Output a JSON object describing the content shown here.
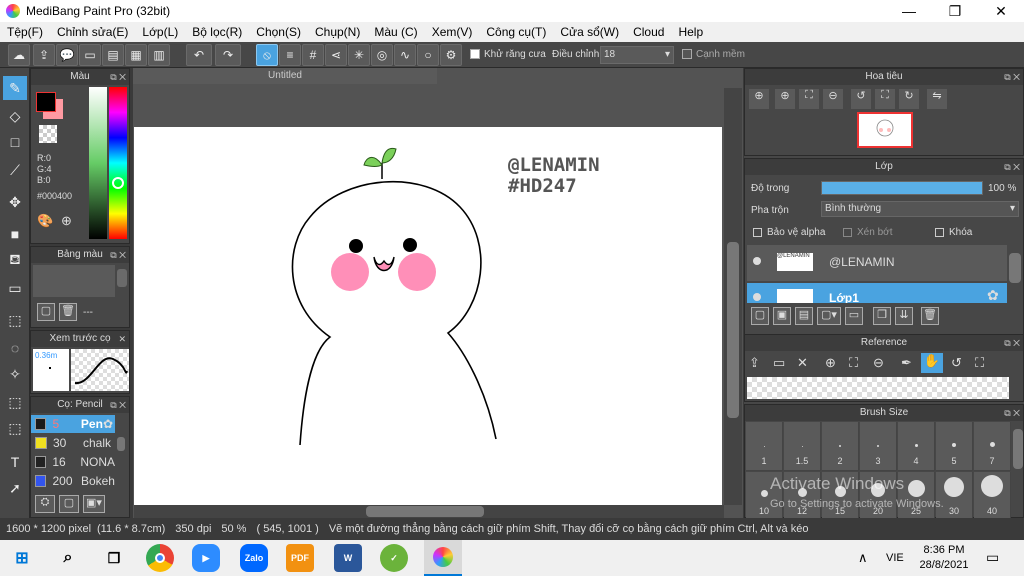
{
  "window": {
    "title": "MediBang Paint Pro (32bit)",
    "minimize": "—",
    "maximize": "❐",
    "close": "✕"
  },
  "menu": [
    "Tệp(F)",
    "Chỉnh sửa(E)",
    "Lớp(L)",
    "Bộ lọc(R)",
    "Chọn(S)",
    "Chụp(N)",
    "Màu (C)",
    "Xem(V)",
    "Công cụ(T)",
    "Cửa sổ(W)",
    "Cloud",
    "Help"
  ],
  "toolbar": {
    "antialias_label": "Khử răng cưa",
    "adjust_label": "Điều chỉnh",
    "adjust_value": "18",
    "smooth_label": "Cạnh mềm"
  },
  "color_panel": {
    "title": "Màu",
    "r": "R:0",
    "g": "G:4",
    "b": "B:0",
    "hex": "#000400",
    "fg_color": "#000400",
    "bg_color": "#ff9aa2"
  },
  "palette_panel": {
    "title": "Bảng màu",
    "more": "---"
  },
  "brush_preview": {
    "title": "Xem trước cọ",
    "size": "0.36m"
  },
  "brush_list": {
    "title": "Cọ: Pencil",
    "items": [
      {
        "size": "5",
        "name": "Pen",
        "color": "#1a1a1a"
      },
      {
        "size": "30",
        "name": "chalk",
        "color": "#f0e020"
      },
      {
        "size": "16",
        "name": "NONA",
        "color": "#222222"
      },
      {
        "size": "200",
        "name": "Bokeh",
        "color": "#3355ee"
      }
    ]
  },
  "canvas": {
    "tab": "Untitled",
    "watermark1": "@LENAMIN",
    "watermark2": "#HD247"
  },
  "navigator": {
    "title": "Hoa tiêu"
  },
  "layers": {
    "title": "Lớp",
    "opacity_label": "Độ trong",
    "opacity_value": "100 %",
    "opacity": 1.0,
    "blend_label": "Pha trộn",
    "blend_value": "Bình thường",
    "alpha_lock": "Bảo vệ alpha",
    "clipping": "Xén bớt",
    "lock": "Khóa",
    "items": [
      {
        "name": "@LENAMIN",
        "thumb": "@LENAMIN"
      },
      {
        "name": "Lớp1",
        "thumb": ""
      }
    ]
  },
  "reference": {
    "title": "Reference"
  },
  "brush_size": {
    "title": "Brush Size",
    "sizes": [
      "1",
      "1.5",
      "2",
      "3",
      "4",
      "5",
      "7",
      "10",
      "12",
      "15",
      "20",
      "25",
      "30",
      "40"
    ]
  },
  "watermark_os": {
    "line1": "Activate Windows",
    "line2": "Go to Settings to activate Windows."
  },
  "status": {
    "size": "1600 * 1200 pixel",
    "cm": "(11.6 * 8.7cm)",
    "dpi": "350 dpi",
    "zoom": "50 %",
    "coords": "( 545, 1001 )",
    "hint": "Vẽ một đường thẳng bằng cách giữ phím Shift, Thay đổi cỡ cọ bằng cách giữ phím Ctrl, Alt và kéo"
  },
  "taskbar": {
    "lang": "VIE",
    "time": "8:36 PM",
    "date": "28/8/2021",
    "zalo": "Zalo",
    "pdf": "PDF",
    "word": "W"
  }
}
